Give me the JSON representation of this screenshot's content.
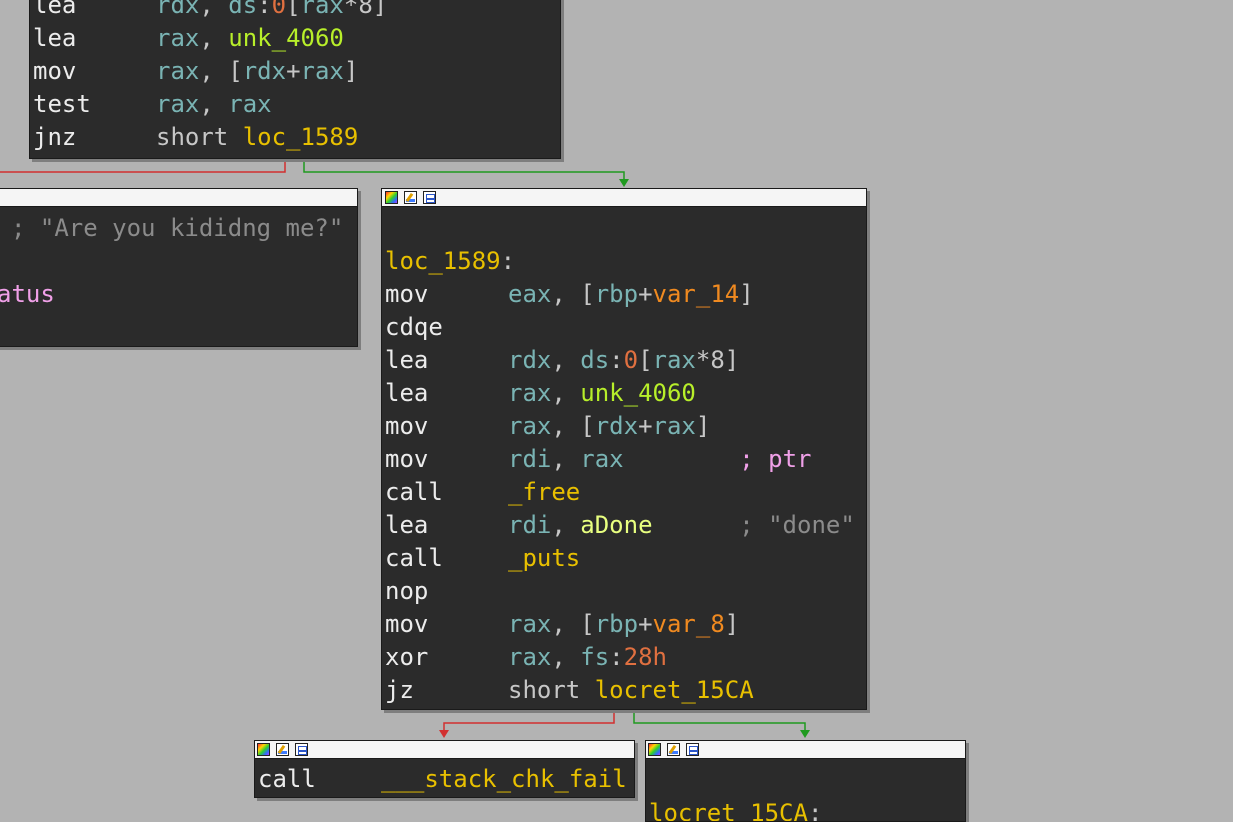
{
  "blocks": {
    "top": {
      "lines": [
        {
          "mn": "lea",
          "ops": [
            {
              "t": "rdx",
              "c": "r"
            },
            {
              "t": ", ",
              "c": "p"
            },
            {
              "t": "ds",
              "c": "r"
            },
            {
              "t": ":",
              "c": "p"
            },
            {
              "t": "0",
              "c": "n"
            },
            {
              "t": "[",
              "c": "p"
            },
            {
              "t": "rax",
              "c": "r"
            },
            {
              "t": "*8]",
              "c": "p"
            }
          ]
        },
        {
          "mn": "lea",
          "ops": [
            {
              "t": "rax",
              "c": "r"
            },
            {
              "t": ", ",
              "c": "p"
            },
            {
              "t": "unk_4060",
              "c": "g"
            }
          ]
        },
        {
          "mn": "mov",
          "ops": [
            {
              "t": "rax",
              "c": "r"
            },
            {
              "t": ", [",
              "c": "p"
            },
            {
              "t": "rdx",
              "c": "r"
            },
            {
              "t": "+",
              "c": "p"
            },
            {
              "t": "rax",
              "c": "r"
            },
            {
              "t": "]",
              "c": "p"
            }
          ]
        },
        {
          "mn": "test",
          "ops": [
            {
              "t": "rax",
              "c": "r"
            },
            {
              "t": ", ",
              "c": "p"
            },
            {
              "t": "rax",
              "c": "r"
            }
          ]
        },
        {
          "mn": "jnz",
          "ops": [
            {
              "t": "short ",
              "c": "p"
            },
            {
              "t": "loc_1589",
              "c": "o"
            }
          ]
        }
      ]
    },
    "left": {
      "lines": [
        {
          "mn": "",
          "ops": [
            {
              "t": "; \"Are you kididng me?\"",
              "c": "c"
            }
          ]
        },
        {
          "mn": "",
          "ops": []
        },
        {
          "mn": "",
          "ops": [
            {
              "t": "atus",
              "c": "k"
            }
          ]
        }
      ]
    },
    "main": {
      "lines": [
        {
          "mn": "",
          "ops": []
        },
        {
          "mn": "",
          "label": "loc_1589",
          "ops": []
        },
        {
          "mn": "mov",
          "ops": [
            {
              "t": "eax",
              "c": "r"
            },
            {
              "t": ", [",
              "c": "p"
            },
            {
              "t": "rbp",
              "c": "r"
            },
            {
              "t": "+",
              "c": "p"
            },
            {
              "t": "var_14",
              "c": "v"
            },
            {
              "t": "]",
              "c": "p"
            }
          ]
        },
        {
          "mn": "cdqe",
          "ops": []
        },
        {
          "mn": "lea",
          "ops": [
            {
              "t": "rdx",
              "c": "r"
            },
            {
              "t": ", ",
              "c": "p"
            },
            {
              "t": "ds",
              "c": "r"
            },
            {
              "t": ":",
              "c": "p"
            },
            {
              "t": "0",
              "c": "n"
            },
            {
              "t": "[",
              "c": "p"
            },
            {
              "t": "rax",
              "c": "r"
            },
            {
              "t": "*8]",
              "c": "p"
            }
          ]
        },
        {
          "mn": "lea",
          "ops": [
            {
              "t": "rax",
              "c": "r"
            },
            {
              "t": ", ",
              "c": "p"
            },
            {
              "t": "unk_4060",
              "c": "g"
            }
          ]
        },
        {
          "mn": "mov",
          "ops": [
            {
              "t": "rax",
              "c": "r"
            },
            {
              "t": ", [",
              "c": "p"
            },
            {
              "t": "rdx",
              "c": "r"
            },
            {
              "t": "+",
              "c": "p"
            },
            {
              "t": "rax",
              "c": "r"
            },
            {
              "t": "]",
              "c": "p"
            }
          ]
        },
        {
          "mn": "mov",
          "ops": [
            {
              "t": "rdi",
              "c": "r"
            },
            {
              "t": ", ",
              "c": "p"
            },
            {
              "t": "rax",
              "c": "r"
            },
            {
              "t": "        ; ",
              "c": "k"
            },
            {
              "t": "ptr",
              "c": "k"
            }
          ]
        },
        {
          "mn": "call",
          "ops": [
            {
              "t": "_free",
              "c": "o"
            }
          ]
        },
        {
          "mn": "lea",
          "ops": [
            {
              "t": "rdi",
              "c": "r"
            },
            {
              "t": ", ",
              "c": "p"
            },
            {
              "t": "aDone",
              "c": "cl"
            },
            {
              "t": "      ; \"done\"",
              "c": "c"
            }
          ]
        },
        {
          "mn": "call",
          "ops": [
            {
              "t": "_puts",
              "c": "o"
            }
          ]
        },
        {
          "mn": "nop",
          "ops": []
        },
        {
          "mn": "mov",
          "ops": [
            {
              "t": "rax",
              "c": "r"
            },
            {
              "t": ", [",
              "c": "p"
            },
            {
              "t": "rbp",
              "c": "r"
            },
            {
              "t": "+",
              "c": "p"
            },
            {
              "t": "var_8",
              "c": "v"
            },
            {
              "t": "]",
              "c": "p"
            }
          ]
        },
        {
          "mn": "xor",
          "ops": [
            {
              "t": "rax",
              "c": "r"
            },
            {
              "t": ", ",
              "c": "p"
            },
            {
              "t": "fs",
              "c": "r"
            },
            {
              "t": ":",
              "c": "p"
            },
            {
              "t": "28h",
              "c": "n"
            }
          ]
        },
        {
          "mn": "jz",
          "ops": [
            {
              "t": "short ",
              "c": "p"
            },
            {
              "t": "locret_15CA",
              "c": "o"
            }
          ]
        }
      ]
    },
    "fail": {
      "lines": [
        {
          "mn": "call",
          "ops": [
            {
              "t": "___stack_chk_fail",
              "c": "o"
            }
          ]
        }
      ]
    },
    "ret": {
      "lines": [
        {
          "mn": "",
          "ops": []
        },
        {
          "mn": "",
          "label": "locret_15CA",
          "ops": []
        }
      ]
    }
  },
  "colors": {
    "background": "#b3b3b3",
    "block_bg": "#2b2b2b",
    "edge_false": "#d23030",
    "edge_true": "#1f9a1f"
  },
  "icons": [
    "color-palette-icon",
    "edit-icon",
    "graph-overview-icon"
  ]
}
